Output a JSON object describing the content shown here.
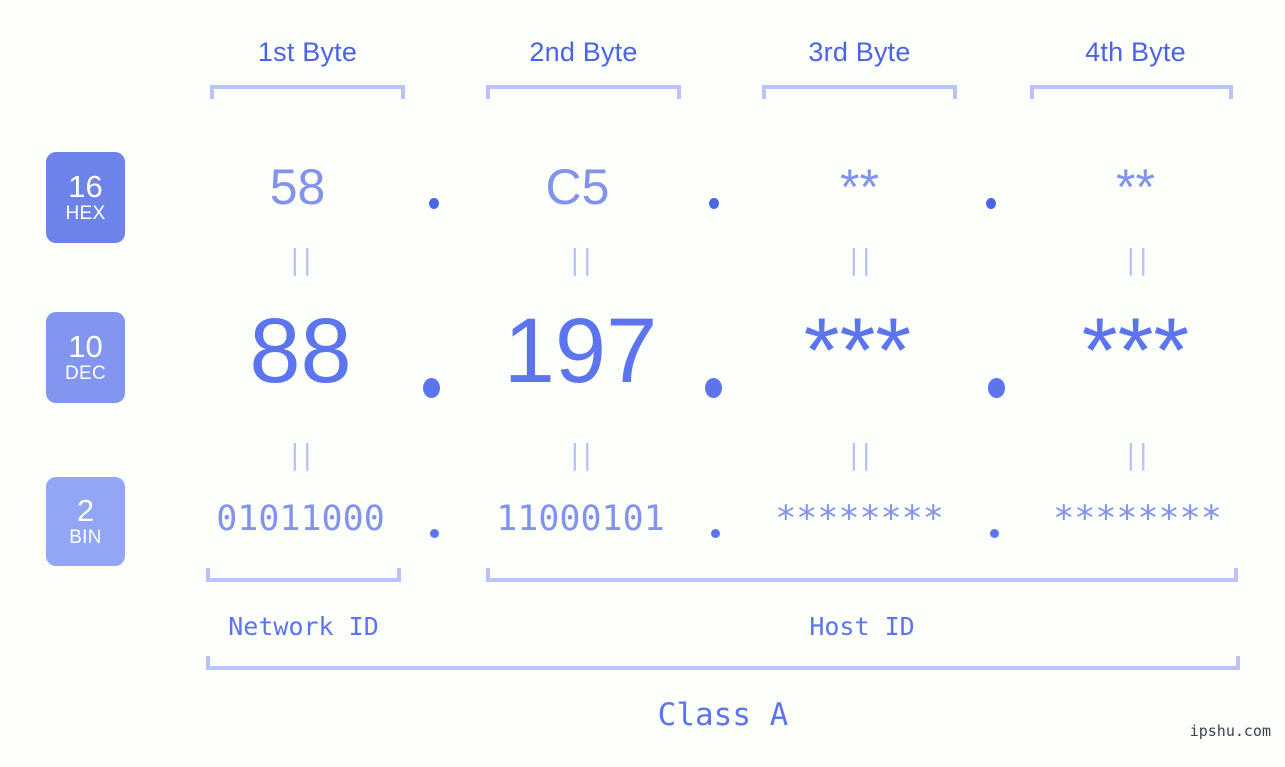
{
  "page": {
    "background_color": "#fcfefa",
    "accent_color": "#5c75ee",
    "accent_light_color": "#8193ec",
    "bracket_color": "#b9c3f7",
    "watermark": "ipshu.com"
  },
  "byte_headers": [
    {
      "label": "1st Byte"
    },
    {
      "label": "2nd Byte"
    },
    {
      "label": "3rd Byte"
    },
    {
      "label": "4th Byte"
    }
  ],
  "rows": [
    {
      "id": "hex",
      "badge": {
        "base": "16",
        "name": "HEX",
        "color": "#6e83ea"
      },
      "values": [
        "58",
        "C5",
        "**",
        "**"
      ],
      "separator": "."
    },
    {
      "id": "dec",
      "badge": {
        "base": "10",
        "name": "DEC",
        "color": "#8296ef"
      },
      "values": [
        "88",
        "197",
        "***",
        "***"
      ],
      "separator": "."
    },
    {
      "id": "bin",
      "badge": {
        "base": "2",
        "name": "BIN",
        "color": "#93a6f6"
      },
      "values": [
        "01011000",
        "11000101",
        "********",
        "********"
      ],
      "separator": "."
    }
  ],
  "equals_marks": {
    "symbol": "||",
    "rows": [
      "hex-to-dec",
      "dec-to-bin"
    ]
  },
  "id_captions": [
    {
      "label": "Network ID",
      "span": "1st byte"
    },
    {
      "label": "Host ID",
      "span": "2nd-4th bytes"
    }
  ],
  "class_caption": {
    "label": "Class A"
  }
}
